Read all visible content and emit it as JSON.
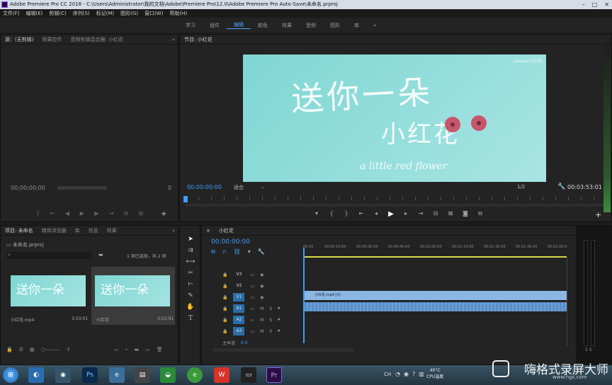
{
  "window": {
    "title": "Adobe Premiere Pro CC 2018 - C:\\Users\\Administrator\\我的文档\\Adobe\\Premiere Pro\\12.0\\Adobe Premiere Pro Auto-Save\\未命名.prproj"
  },
  "menu": [
    "文件(F)",
    "编辑(E)",
    "剪辑(C)",
    "序列(S)",
    "标记(M)",
    "图形(G)",
    "窗口(W)",
    "帮助(H)"
  ],
  "workspaces": {
    "items": [
      "学习",
      "组件",
      "编辑",
      "颜色",
      "效果",
      "音频",
      "图形",
      "库"
    ],
    "active": "编辑",
    "more": "»"
  },
  "source_panel": {
    "tabs": [
      "源：(无剪辑)",
      "效果控件",
      "音频剪辑混合器: 小红花"
    ],
    "more": "»",
    "timecode": "00;00;00;00",
    "page": "0"
  },
  "program_panel": {
    "title": "节目: 小红花",
    "timecode_in": "00:00:00:00",
    "fit": "适合",
    "ratio": "1/2",
    "duration": "00:03:53:01",
    "video_text": {
      "line1": "送你一朵",
      "line2": "小红花",
      "line3": "a little red flower",
      "watermark": "aaaaaa小红花"
    }
  },
  "project_panel": {
    "tabs": [
      "项目: 未命名",
      "媒体浏览器",
      "库",
      "信息",
      "效果"
    ],
    "more": "»",
    "file": "未命名.prproj",
    "status": "1 项已选择，共 2 项",
    "items": [
      {
        "name": "小红花.mp4",
        "duration": "3:53:01"
      },
      {
        "name": "小红花",
        "duration": "3:53:01"
      }
    ]
  },
  "timeline": {
    "title": "小红花",
    "timecode": "00:00:00:00",
    "ruler": [
      "00:00",
      "00:00:15:00",
      "00:00:30:00",
      "00:00:45:00",
      "00:01:00:00",
      "00:01:15:00",
      "00:01:30:00",
      "00:01:45:00",
      "00:02:00:0"
    ],
    "video_tracks": [
      "V3",
      "V2",
      "V1"
    ],
    "audio_tracks": [
      "A1",
      "A2",
      "A3"
    ],
    "master": "主声道",
    "master_value": "0.0",
    "clip_label": "小红花.mp4 [V]"
  },
  "meter_label": "S S",
  "taskbar": {
    "apps": [
      "Ps",
      "Pr"
    ],
    "tray": {
      "ime": "CH",
      "temp": "40°C",
      "cpu": "CPU温度"
    },
    "brand": "嗨格式录屏大师",
    "brand_url": "www.hgs.com"
  }
}
